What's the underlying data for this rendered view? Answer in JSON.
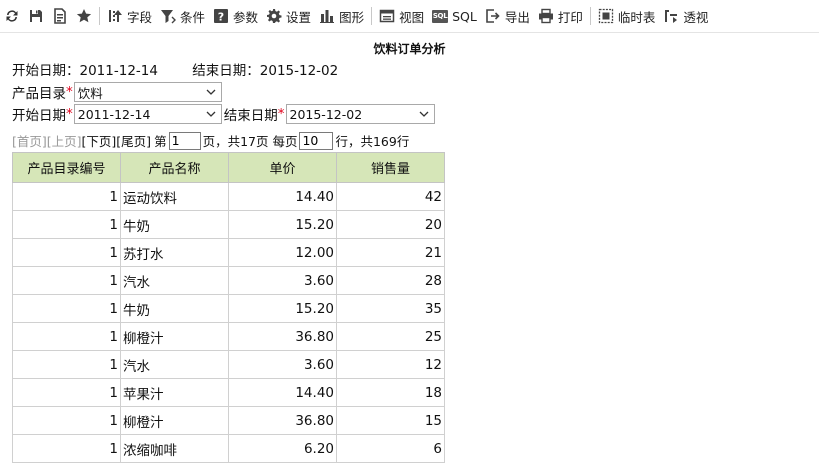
{
  "toolbar": {
    "refresh_icon": "refresh-icon",
    "save_icon": "save-icon",
    "saveas_icon": "save-as-icon",
    "favorite_icon": "star-icon",
    "fields_label": "字段",
    "conditions_label": "条件",
    "params_label": "参数",
    "settings_label": "设置",
    "chart_label": "图形",
    "view_label": "视图",
    "sql_label": "SQL",
    "export_label": "导出",
    "print_label": "打印",
    "temp_table_label": "临时表",
    "pivot_label": "透视"
  },
  "report": {
    "title": "饮料订单分析",
    "start_text": "开始日期：2011-12-14",
    "end_text": "结束日期：2015-12-02"
  },
  "filters": {
    "category_label": "产品目录",
    "category_value": "饮料",
    "start_label": "开始日期",
    "start_value": "2011-12-14",
    "end_label": "结束日期",
    "end_value": "2015-12-02",
    "required_mark": "*"
  },
  "pager": {
    "first": "[首页]",
    "prev": "[上页]",
    "next": "[下页]",
    "last": "[尾页]",
    "page_prefix": "第",
    "page_value": "1",
    "page_suffix": "页，共17页 每页",
    "per_page_value": "10",
    "rows_suffix": "行，共169行"
  },
  "table": {
    "headers": [
      "产品目录编号",
      "产品名称",
      "单价",
      "销售量"
    ],
    "rows": [
      [
        "1",
        "运动饮料",
        "14.40",
        "42"
      ],
      [
        "1",
        "牛奶",
        "15.20",
        "20"
      ],
      [
        "1",
        "苏打水",
        "12.00",
        "21"
      ],
      [
        "1",
        "汽水",
        "3.60",
        "28"
      ],
      [
        "1",
        "牛奶",
        "15.20",
        "35"
      ],
      [
        "1",
        "柳橙汁",
        "36.80",
        "25"
      ],
      [
        "1",
        "汽水",
        "3.60",
        "12"
      ],
      [
        "1",
        "苹果汁",
        "14.40",
        "18"
      ],
      [
        "1",
        "柳橙汁",
        "36.80",
        "15"
      ],
      [
        "1",
        "浓缩咖啡",
        "6.20",
        "6"
      ]
    ]
  }
}
